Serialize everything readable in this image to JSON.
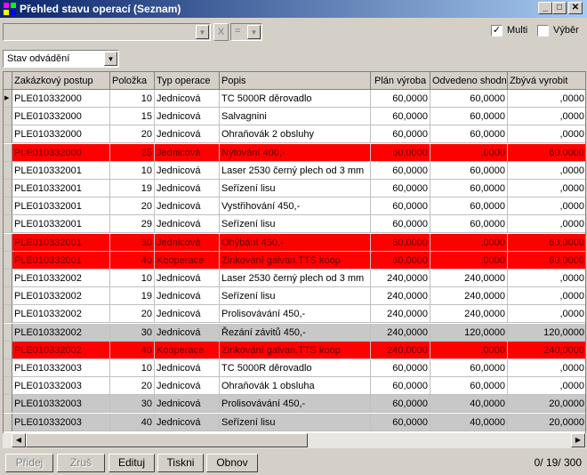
{
  "window": {
    "title": "Přehled stavu operací (Seznam)"
  },
  "toolbar": {
    "filter_x": "X",
    "filter_eq": "=",
    "multi_label": "Multi",
    "multi_checked": true,
    "vyber_label": "Výběr",
    "vyber_checked": false,
    "stav_combo_value": "Stav odvádění"
  },
  "grid": {
    "columns": [
      "Zakázkový postup",
      "Položka",
      "Typ operace",
      "Popis",
      "Plán výroba",
      "Odvedeno shodn",
      "Zbývá vyrobit"
    ],
    "rows": [
      {
        "zp": "PLE010332000",
        "pol": "10",
        "typ": "Jednicová",
        "popis": "TC 5000R děrovadlo",
        "plan": "60,0000",
        "odv": "60,0000",
        "zby": ",0000",
        "style": "normal",
        "current": true
      },
      {
        "zp": "PLE010332000",
        "pol": "15",
        "typ": "Jednicová",
        "popis": "Salvagnini",
        "plan": "60,0000",
        "odv": "60,0000",
        "zby": ",0000",
        "style": "normal"
      },
      {
        "zp": "PLE010332000",
        "pol": "20",
        "typ": "Jednicová",
        "popis": "Ohraňovák 2 obsluhy",
        "plan": "60,0000",
        "odv": "60,0000",
        "zby": ",0000",
        "style": "normal"
      },
      {
        "zp": "PLE010332000",
        "pol": "25",
        "typ": "Jednicová",
        "popis": "Nýtování 400,-",
        "plan": "60,0000",
        "odv": ",0000",
        "zby": "60,0000",
        "style": "red"
      },
      {
        "zp": "PLE010332001",
        "pol": "10",
        "typ": "Jednicová",
        "popis": "Laser 2530 černý plech od 3 mm",
        "plan": "60,0000",
        "odv": "60,0000",
        "zby": ",0000",
        "style": "normal"
      },
      {
        "zp": "PLE010332001",
        "pol": "19",
        "typ": "Jednicová",
        "popis": "Seřízení lisu",
        "plan": "60,0000",
        "odv": "60,0000",
        "zby": ",0000",
        "style": "normal"
      },
      {
        "zp": "PLE010332001",
        "pol": "20",
        "typ": "Jednicová",
        "popis": "Vystřihování 450,-",
        "plan": "60,0000",
        "odv": "60,0000",
        "zby": ",0000",
        "style": "normal"
      },
      {
        "zp": "PLE010332001",
        "pol": "29",
        "typ": "Jednicová",
        "popis": "Seřízení lisu",
        "plan": "60,0000",
        "odv": "60,0000",
        "zby": ",0000",
        "style": "normal"
      },
      {
        "zp": "PLE010332001",
        "pol": "30",
        "typ": "Jednicová",
        "popis": "Ohýbání 450,-",
        "plan": "60,0000",
        "odv": ",0000",
        "zby": "60,0000",
        "style": "red"
      },
      {
        "zp": "PLE010332001",
        "pol": "40",
        "typ": "Kooperace",
        "popis": "Zinkování galvan.TTS koop",
        "plan": "60,0000",
        "odv": ",0000",
        "zby": "60,0000",
        "style": "red"
      },
      {
        "zp": "PLE010332002",
        "pol": "10",
        "typ": "Jednicová",
        "popis": "Laser 2530 černý plech od 3 mm",
        "plan": "240,0000",
        "odv": "240,0000",
        "zby": ",0000",
        "style": "normal"
      },
      {
        "zp": "PLE010332002",
        "pol": "19",
        "typ": "Jednicová",
        "popis": "Seřízení lisu",
        "plan": "240,0000",
        "odv": "240,0000",
        "zby": ",0000",
        "style": "normal"
      },
      {
        "zp": "PLE010332002",
        "pol": "20",
        "typ": "Jednicová",
        "popis": "Prolisovávání 450,-",
        "plan": "240,0000",
        "odv": "240,0000",
        "zby": ",0000",
        "style": "normal"
      },
      {
        "zp": "PLE010332002",
        "pol": "30",
        "typ": "Jednicová",
        "popis": "Řezání závitů 450,-",
        "plan": "240,0000",
        "odv": "120,0000",
        "zby": "120,0000",
        "style": "gray"
      },
      {
        "zp": "PLE010332002",
        "pol": "40",
        "typ": "Kooperace",
        "popis": "Zinkování galvan.TTS koop",
        "plan": "240,0000",
        "odv": ",0000",
        "zby": "240,0000",
        "style": "red"
      },
      {
        "zp": "PLE010332003",
        "pol": "10",
        "typ": "Jednicová",
        "popis": "TC 5000R děrovadlo",
        "plan": "60,0000",
        "odv": "60,0000",
        "zby": ",0000",
        "style": "normal"
      },
      {
        "zp": "PLE010332003",
        "pol": "20",
        "typ": "Jednicová",
        "popis": "Ohraňovák 1 obsluha",
        "plan": "60,0000",
        "odv": "60,0000",
        "zby": ",0000",
        "style": "normal"
      },
      {
        "zp": "PLE010332003",
        "pol": "30",
        "typ": "Jednicová",
        "popis": "Prolisovávání 450,-",
        "plan": "60,0000",
        "odv": "40,0000",
        "zby": "20,0000",
        "style": "gray"
      },
      {
        "zp": "PLE010332003",
        "pol": "40",
        "typ": "Jednicová",
        "popis": "Seřízení lisu",
        "plan": "60,0000",
        "odv": "40,0000",
        "zby": "20,0000",
        "style": "gray"
      }
    ]
  },
  "buttons": {
    "add": "Přidej",
    "cancel": "Zruš",
    "edit": "Edituj",
    "print": "Tiskni",
    "refresh": "Obnov"
  },
  "status": {
    "counter": "0/ 19/ 300"
  },
  "colors": {
    "highlight_red": "#ff0000",
    "partial_gray": "#c8c8c8",
    "title_blue": "#0a246a"
  }
}
